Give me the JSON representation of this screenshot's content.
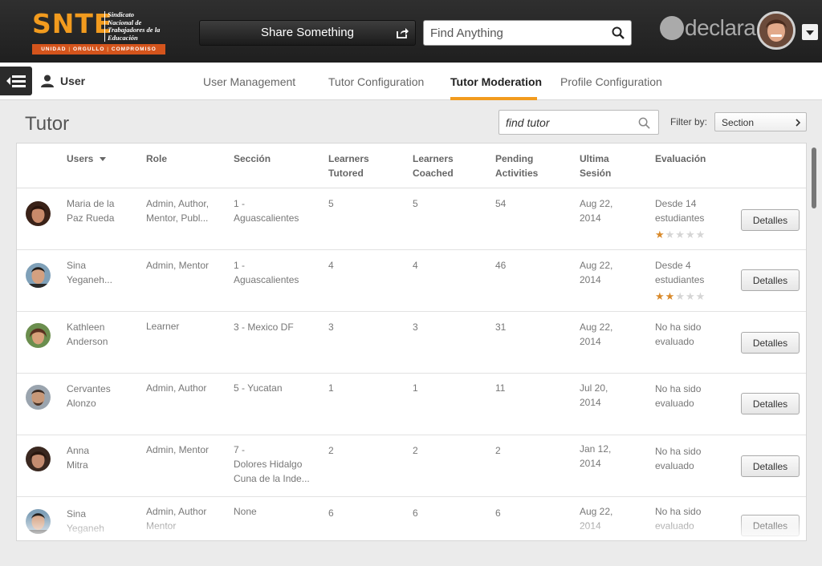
{
  "header": {
    "logo": {
      "main": "SNTE",
      "lines": [
        "Sindicato",
        "Nacional de",
        "Trabajadores de la",
        "Educación"
      ],
      "tagline": [
        "UNIDAD",
        "ORGULLO",
        "COMPROMISO"
      ]
    },
    "share_label": "Share Something",
    "search_placeholder": "Find Anything",
    "brand": "declara"
  },
  "subnav": {
    "user_label": "User",
    "tabs": [
      {
        "label": "User Management"
      },
      {
        "label": "Tutor Configuration"
      },
      {
        "label": "Tutor Moderation",
        "active": true
      },
      {
        "label": "Profile Configuration"
      }
    ],
    "accent_color": "#f29b1e"
  },
  "page": {
    "title": "Tutor",
    "search_placeholder": "find tutor",
    "filter_label": "Filter by:",
    "filter_value": "Section"
  },
  "table": {
    "columns": {
      "users": "Users",
      "role": "Role",
      "seccion": "Sección",
      "tutored": [
        "Learners",
        "Tutored"
      ],
      "coached": [
        "Learners",
        "Coached"
      ],
      "pending": [
        "Pending",
        "Activities"
      ],
      "ultima": [
        "Ultima",
        "Sesión"
      ],
      "evaluacion": "Evaluación"
    },
    "button_label": "Detalles",
    "rows": [
      {
        "name": [
          "Maria de la",
          "Paz Rueda"
        ],
        "role": [
          "Admin, Author,",
          "Mentor, Publ..."
        ],
        "section": [
          "1 -",
          "Aguascalientes"
        ],
        "tutored": "5",
        "coached": "5",
        "pending": "54",
        "session": [
          "Aug 22,",
          "2014"
        ],
        "evaluation": [
          "Desde 14",
          "estudiantes"
        ],
        "rating": 1
      },
      {
        "name": [
          "Sina",
          "Yeganeh..."
        ],
        "role": [
          "Admin, Mentor"
        ],
        "section": [
          "1 -",
          "Aguascalientes"
        ],
        "tutored": "4",
        "coached": "4",
        "pending": "46",
        "session": [
          "Aug 22,",
          "2014"
        ],
        "evaluation": [
          "Desde 4",
          "estudiantes"
        ],
        "rating": 2
      },
      {
        "name": [
          "Kathleen",
          "Anderson"
        ],
        "role": [
          "Learner"
        ],
        "section": [
          "3 - Mexico DF"
        ],
        "tutored": "3",
        "coached": "3",
        "pending": "31",
        "session": [
          "Aug 22,",
          "2014"
        ],
        "evaluation": [
          "No ha sido",
          "evaluado"
        ],
        "rating": null
      },
      {
        "name": [
          "Cervantes",
          "Alonzo"
        ],
        "role": [
          "Admin, Author"
        ],
        "section": [
          "5 - Yucatan"
        ],
        "tutored": "1",
        "coached": "1",
        "pending": "11",
        "session": [
          "Jul 20,",
          "2014"
        ],
        "evaluation": [
          "No ha sido",
          "evaluado"
        ],
        "rating": null
      },
      {
        "name": [
          "Anna",
          "Mitra"
        ],
        "role": [
          "Admin, Mentor"
        ],
        "section": [
          "7 -",
          "Dolores Hidalgo",
          "Cuna de la Inde..."
        ],
        "tutored": "2",
        "coached": "2",
        "pending": "2",
        "session": [
          "Jan 12,",
          "2014"
        ],
        "evaluation": [
          "No ha sido",
          "evaluado"
        ],
        "rating": null
      },
      {
        "name": [
          "Sina",
          "Yeganeh"
        ],
        "role": [
          "Admin, Author",
          "Mentor"
        ],
        "section": [
          "None"
        ],
        "tutored": "6",
        "coached": "6",
        "pending": "6",
        "session": [
          "Aug 22,",
          "2014"
        ],
        "evaluation": [
          "No ha sido",
          "evaluado"
        ],
        "rating": null
      }
    ]
  }
}
